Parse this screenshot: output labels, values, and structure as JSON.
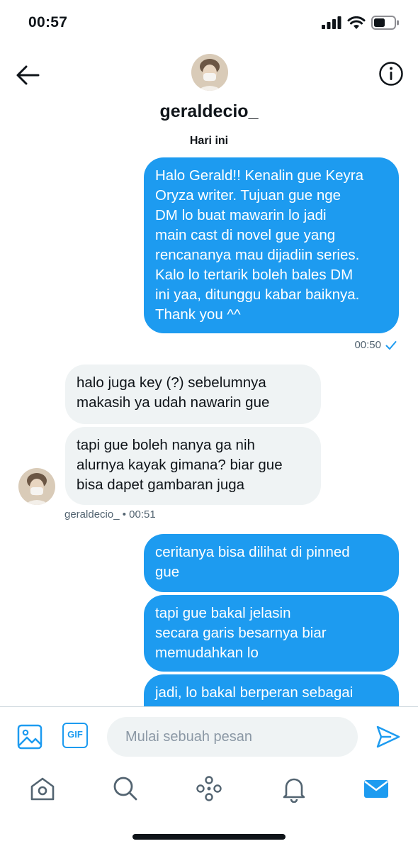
{
  "status_bar": {
    "time": "00:57"
  },
  "header": {
    "username": "geraldecio_"
  },
  "date_separator": "Hari ini",
  "messages": {
    "out_1": "Halo Gerald!! Kenalin gue Keyra\nOryza writer. Tujuan gue nge\nDM lo buat mawarin lo jadi\nmain cast di novel gue yang\nrencananya mau dijadiin series.\nKalo lo tertarik boleh bales DM\nini yaa, ditunggu kabar baiknya.\nThank you ^^",
    "out_1_time": "00:50",
    "in_1": "halo juga key (?) sebelumnya\nmakasih ya udah nawarin gue",
    "in_2": "tapi gue boleh nanya ga nih\nalurnya kayak gimana? biar gue\nbisa dapet gambaran juga",
    "in_meta": "geraldecio_  • 00:51",
    "out_2": "ceritanya bisa dilihat di pinned\ngue",
    "out_3": "tapi gue bakal jelasin\nsecara garis besarnya biar\nmemudahkan lo",
    "out_4": "jadi, lo bakal berperan sebagai"
  },
  "composer": {
    "gif_label": "GIF",
    "placeholder": "Mulai sebuah pesan"
  },
  "colors": {
    "accent": "#1d9bf0",
    "incoming_bubble": "#eff3f4",
    "text": "#0f1419",
    "muted": "#536471"
  },
  "icons": [
    "back-arrow-icon",
    "info-icon",
    "media-icon",
    "send-icon",
    "home-icon",
    "search-icon",
    "spaces-icon",
    "notifications-icon",
    "messages-icon"
  ]
}
